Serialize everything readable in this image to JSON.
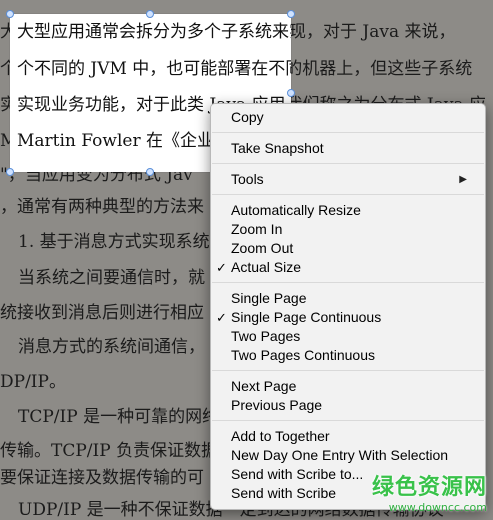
{
  "document": {
    "lines": [
      "大型应用通常会拆分为多个子系统来实现，对于 Java 来说，",
      "个不同的 JVM 中，也可能部署在不同的机器上，但这些子系统",
      "实现业务功能，对于此类 Java 应用，我们称之为分布式 Java 应",
      "Martin  Fowler 在《企业应",
      "\"，当应用变为分布式 Jav",
      "，通常有两种典型的方法来",
      "1. 基于消息方式实现系统",
      "当系统之间要通信时，就",
      "统接收到消息后则进行相应",
      "消息方式的系统间通信，",
      "DP/IP。",
      "TCP/IP 是一种可靠的网络",
      "传输。TCP/IP 负责保证数据",
      "要保证连接及数据传输的可",
      "UDP/IP 是一种不保证数据一定到达的网络数据传输协议"
    ],
    "selected_lines": [
      "大型应用通常会拆分为多个子系统来实现，对于 Java 来说，",
      "个不同的 JVM 中，也可能部署在不同的机器上，但这些子系统",
      "实现业务功能，对于此类 Java 应用，我们称之为分布式 Java 应",
      "Martin  Fowler 在《企业应"
    ]
  },
  "context_menu": {
    "items": [
      {
        "label": "Copy",
        "checked": false,
        "submenu": false,
        "sep_after": true
      },
      {
        "label": "Take Snapshot",
        "checked": false,
        "submenu": false,
        "sep_after": true
      },
      {
        "label": "Tools",
        "checked": false,
        "submenu": true,
        "sep_after": true
      },
      {
        "label": "Automatically Resize",
        "checked": false,
        "submenu": false,
        "sep_after": false
      },
      {
        "label": "Zoom In",
        "checked": false,
        "submenu": false,
        "sep_after": false
      },
      {
        "label": "Zoom Out",
        "checked": false,
        "submenu": false,
        "sep_after": false
      },
      {
        "label": "Actual Size",
        "checked": true,
        "submenu": false,
        "sep_after": true
      },
      {
        "label": "Single Page",
        "checked": false,
        "submenu": false,
        "sep_after": false
      },
      {
        "label": "Single Page Continuous",
        "checked": true,
        "submenu": false,
        "sep_after": false
      },
      {
        "label": "Two Pages",
        "checked": false,
        "submenu": false,
        "sep_after": false
      },
      {
        "label": "Two Pages Continuous",
        "checked": false,
        "submenu": false,
        "sep_after": true
      },
      {
        "label": "Next Page",
        "checked": false,
        "submenu": false,
        "sep_after": false
      },
      {
        "label": "Previous Page",
        "checked": false,
        "submenu": false,
        "sep_after": true
      },
      {
        "label": "Add to Together",
        "checked": false,
        "submenu": false,
        "sep_after": false
      },
      {
        "label": "New Day One Entry With Selection",
        "checked": false,
        "submenu": false,
        "sep_after": false
      },
      {
        "label": "Send with Scribe to...",
        "checked": false,
        "submenu": false,
        "sep_after": false
      },
      {
        "label": "Send with Scribe",
        "checked": false,
        "submenu": false,
        "sep_after": false
      }
    ],
    "checkmark_glyph": "✓",
    "submenu_glyph": "▶"
  },
  "watermark": {
    "main": "绿色资源网",
    "url": "www.downcc.com"
  },
  "colors": {
    "page_dim": "#8d8b87",
    "selection_bg": "#ffffff",
    "selection_handle": "#5b8fd8",
    "menu_bg": "#f2f2f2",
    "watermark_green": "#39c24a"
  }
}
